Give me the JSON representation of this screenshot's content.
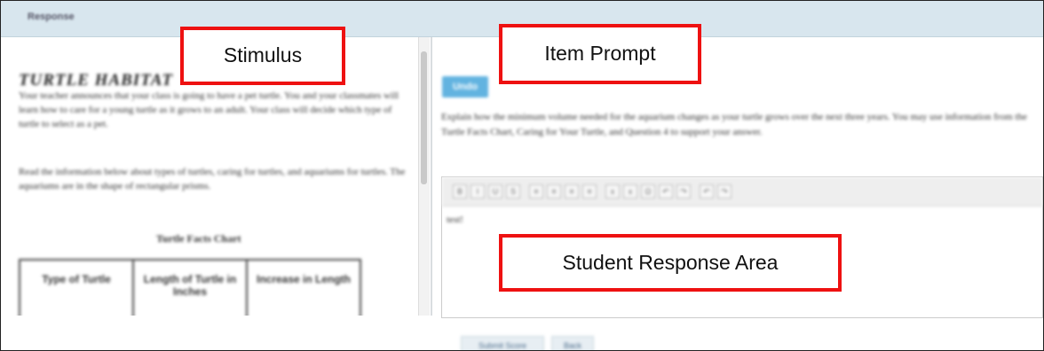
{
  "header": {
    "title": "Response"
  },
  "stimulus": {
    "title": "TURTLE HABITAT",
    "paragraph1": "Your teacher announces that your class is going to have a pet turtle. You and your classmates will learn how to care for a young turtle as it grows to an adult. Your class will decide which type of turtle to select as a pet.",
    "paragraph2": "Read the information below about types of turtles, caring for turtles, and aquariums for turtles. The aquariums are in the shape of rectangular prisms.",
    "chart_title": "Turtle Facts Chart",
    "table_headers": [
      "Type of Turtle",
      "Length of Turtle in Inches",
      "Increase in Length"
    ]
  },
  "prompt": {
    "badge": "Undo",
    "text": "Explain how the minimum volume needed for the aquarium changes as your turtle grows over the next three years. You may use information from the Turtle Facts Chart, Caring for Your Turtle, and Question 4 to support your answer."
  },
  "editor": {
    "toolbar_buttons": [
      "B",
      "I",
      "U",
      "S",
      "≡",
      "≡",
      "≡",
      "≡",
      "x",
      "x",
      "Ω",
      "↶",
      "↷",
      "↶",
      "↷"
    ],
    "content": "test!"
  },
  "footer": {
    "submit_label": "Submit Score",
    "back_label": "Back"
  },
  "annotations": {
    "stimulus": "Stimulus",
    "item_prompt": "Item Prompt",
    "response_area": "Student Response Area",
    "color": "#ee1111"
  }
}
